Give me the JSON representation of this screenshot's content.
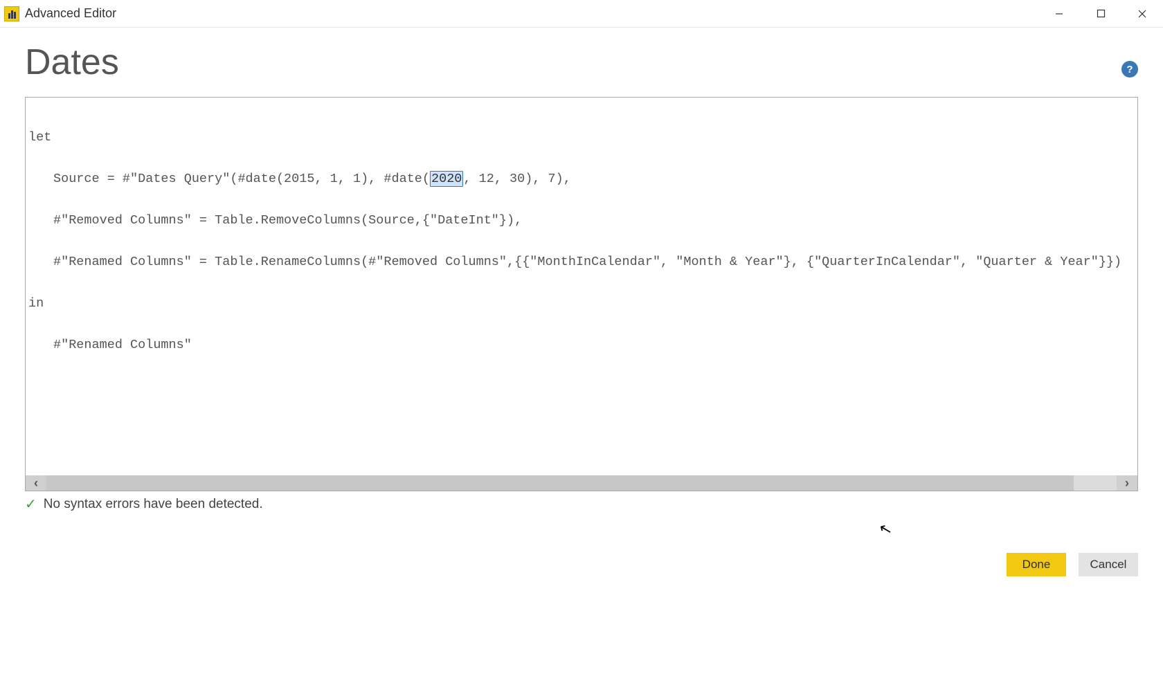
{
  "window": {
    "title": "Advanced Editor"
  },
  "header": {
    "query_name": "Dates"
  },
  "code": {
    "line1": "let",
    "line2_pre": "Source = #\"Dates Query\"(#date(2015, 1, 1), #date(",
    "line2_sel": "2020",
    "line2_post": ", 12, 30), 7),",
    "line3": "#\"Removed Columns\" = Table.RemoveColumns(Source,{\"DateInt\"}),",
    "line4": "#\"Renamed Columns\" = Table.RenameColumns(#\"Removed Columns\",{{\"MonthInCalendar\", \"Month & Year\"}, {\"QuarterInCalendar\", \"Quarter & Year\"}})",
    "line5": "in",
    "line6": "#\"Renamed Columns\""
  },
  "status": {
    "message": "No syntax errors have been detected."
  },
  "buttons": {
    "done": "Done",
    "cancel": "Cancel"
  },
  "scroll": {
    "left": "‹",
    "right": "›"
  },
  "help": {
    "glyph": "?"
  },
  "check_glyph": "✓"
}
